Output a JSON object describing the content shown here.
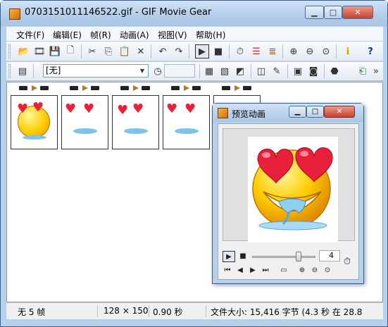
{
  "window": {
    "title": "0703151011146522.gif - GIF Movie Gear",
    "minimize": "▁",
    "maximize": "□",
    "close": "✕"
  },
  "menu": [
    {
      "label": "文件(F)"
    },
    {
      "label": "编辑(E)"
    },
    {
      "label": "帧(R)"
    },
    {
      "label": "动画(A)"
    },
    {
      "label": "视图(V)"
    },
    {
      "label": "帮助(H)"
    }
  ],
  "toolbar1": {
    "icons": [
      {
        "name": "open-icon",
        "glyph": "📂"
      },
      {
        "name": "filmstrip-icon",
        "glyph": "🎞"
      },
      {
        "name": "save-icon",
        "glyph": "💾"
      },
      {
        "name": "new-icon",
        "glyph": "🗋"
      },
      {
        "name": "cut-icon",
        "glyph": "✂"
      },
      {
        "name": "copy-icon",
        "glyph": "⎘"
      },
      {
        "name": "paste-icon",
        "glyph": "📋"
      },
      {
        "name": "delete-icon",
        "glyph": "✕"
      },
      {
        "name": "undo-icon",
        "glyph": "↶"
      },
      {
        "name": "redo-icon",
        "glyph": "↷"
      },
      {
        "name": "play-icon",
        "glyph": "▶"
      },
      {
        "name": "stop-icon",
        "glyph": "■"
      },
      {
        "name": "timer-icon",
        "glyph": "⏱"
      },
      {
        "name": "palette-icon",
        "glyph": "☰"
      },
      {
        "name": "optimize-icon",
        "glyph": "≣"
      },
      {
        "name": "zoom-in-icon",
        "glyph": "⊕"
      },
      {
        "name": "zoom-out-icon",
        "glyph": "⊖"
      },
      {
        "name": "zoom-fit-icon",
        "glyph": "⊙"
      },
      {
        "name": "info-icon",
        "glyph": "ℹ"
      },
      {
        "name": "help-icon",
        "glyph": "?"
      }
    ]
  },
  "toolbar2": {
    "combo_value": "[无]",
    "icons": [
      {
        "name": "properties-icon",
        "glyph": "▤"
      },
      {
        "name": "delay-icon",
        "glyph": "◷"
      },
      {
        "name": "disposal-icon",
        "glyph": "▦"
      },
      {
        "name": "crop-icon",
        "glyph": "▧"
      },
      {
        "name": "rotate-icon",
        "glyph": "◩"
      },
      {
        "name": "insert-icon",
        "glyph": "◫"
      },
      {
        "name": "brush-icon",
        "glyph": "✎"
      },
      {
        "name": "frame-add-icon",
        "glyph": "▣"
      },
      {
        "name": "frame-search-icon",
        "glyph": "◙"
      },
      {
        "name": "transparency-icon",
        "glyph": "⬣"
      },
      {
        "name": "export-icon",
        "glyph": "⎗"
      },
      {
        "name": "more-icon",
        "glyph": "»"
      }
    ]
  },
  "frames": [
    {
      "name": "frame-1"
    },
    {
      "name": "frame-2"
    },
    {
      "name": "frame-3"
    },
    {
      "name": "frame-4"
    },
    {
      "name": "frame-5"
    }
  ],
  "status": {
    "frames": "无 5 帧",
    "size": "128 × 150",
    "delay": "0.90 秒",
    "filesize": "文件大小: 15,416 字节  (4.3 秒 在 28.8"
  },
  "preview": {
    "title": "预览动画",
    "frame_number": "4",
    "slider_fraction": 0.75,
    "controls": [
      {
        "name": "first-frame-icon",
        "glyph": "⏮"
      },
      {
        "name": "prev-frame-icon",
        "glyph": "◀"
      },
      {
        "name": "next-frame-icon",
        "glyph": "▶"
      },
      {
        "name": "last-frame-icon",
        "glyph": "⏭"
      },
      {
        "name": "monitor-icon",
        "glyph": "▭"
      },
      {
        "name": "zoom-in-icon",
        "glyph": "⊕"
      },
      {
        "name": "zoom-out-icon",
        "glyph": "⊖"
      },
      {
        "name": "zoom-fit-icon",
        "glyph": "⊙"
      }
    ]
  },
  "colors": {
    "window_frame": "#b8d1ea",
    "accent_close": "#c8402a",
    "heart": "#e8203a",
    "face": "#ffcc00"
  }
}
